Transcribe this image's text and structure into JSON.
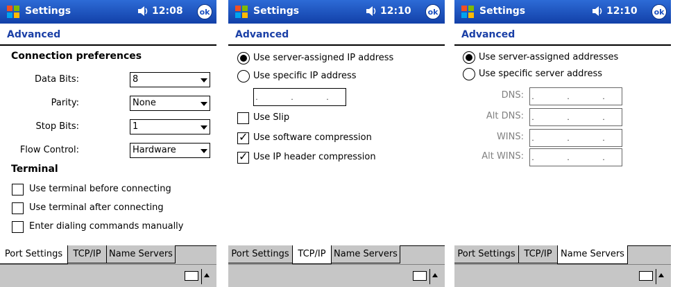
{
  "screens": [
    {
      "title": "Settings",
      "time": "12:08",
      "ok": "ok",
      "section": "Advanced",
      "connection_heading": "Connection preferences",
      "fields": [
        {
          "label": "Data Bits:",
          "value": "8"
        },
        {
          "label": "Parity:",
          "value": "None"
        },
        {
          "label": "Stop Bits:",
          "value": "1"
        },
        {
          "label": "Flow Control:",
          "value": "Hardware"
        }
      ],
      "terminal_heading": "Terminal",
      "checkboxes": [
        {
          "label": "Use terminal before connecting",
          "checked": false
        },
        {
          "label": "Use terminal after connecting",
          "checked": false
        },
        {
          "label": "Enter dialing commands manually",
          "checked": false
        }
      ],
      "tabs": [
        "Port Settings",
        "TCP/IP",
        "Name Servers"
      ],
      "active_tab": 0
    },
    {
      "title": "Settings",
      "time": "12:10",
      "ok": "ok",
      "section": "Advanced",
      "radios": [
        {
          "label": "Use server-assigned IP address",
          "selected": true
        },
        {
          "label": "Use specific IP address",
          "selected": false
        }
      ],
      "ip_placeholder": ". . .",
      "checkboxes": [
        {
          "label": "Use Slip",
          "checked": false
        },
        {
          "label": "Use software compression",
          "checked": true
        },
        {
          "label": "Use IP header compression",
          "checked": true
        }
      ],
      "tabs": [
        "Port Settings",
        "TCP/IP",
        "Name Servers"
      ],
      "active_tab": 1
    },
    {
      "title": "Settings",
      "time": "12:10",
      "ok": "ok",
      "section": "Advanced",
      "radios": [
        {
          "label": "Use server-assigned addresses",
          "selected": true
        },
        {
          "label": "Use specific server address",
          "selected": false
        }
      ],
      "servers": [
        {
          "label": "DNS:",
          "value": ". . ."
        },
        {
          "label": "Alt DNS:",
          "value": ". . ."
        },
        {
          "label": "WINS:",
          "value": ". . ."
        },
        {
          "label": "Alt WINS:",
          "value": ". . ."
        }
      ],
      "tabs": [
        "Port Settings",
        "TCP/IP",
        "Name Servers"
      ],
      "active_tab": 2
    }
  ],
  "icons": {
    "start": "windows-flag-icon",
    "volume": "speaker-icon",
    "keyboard": "keyboard-icon",
    "sip": "arrow-up-icon"
  },
  "colors": {
    "titlebar": "#1a4fc0",
    "section_header": "#1a3fa6",
    "tab_strip": "#c6c6c6"
  }
}
